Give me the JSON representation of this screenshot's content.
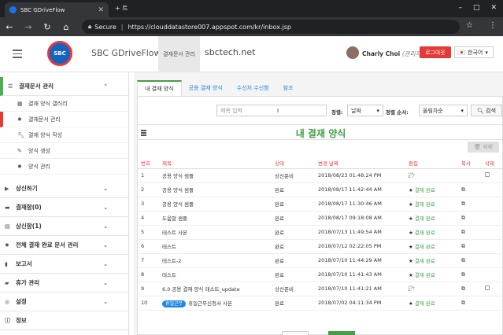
{
  "browser": {
    "tab_title": "SBC GDriveFlow",
    "newtab_label": "+ 트",
    "secure_label": "Secure",
    "url": "https://clouddatastore007.appspot.com/kr/inbox.jsp"
  },
  "header": {
    "app_name": "SBC GDriveFlow",
    "logo_text": "SBC",
    "active_tab": "결재문서 관리",
    "company": "sbctech.net",
    "user_name": "Charly Choi",
    "user_role": "(관리자)",
    "logout_label": "로그아웃",
    "language": "한국어"
  },
  "sidebar": {
    "section_title": "결재문서 관리",
    "subitems": [
      {
        "icon": "grid-icon",
        "label": "결재 양식 갤러리"
      },
      {
        "icon": "gear-icon",
        "label": "결재문서 관리"
      },
      {
        "icon": "wrench-icon",
        "label": "결재 양식 작성"
      },
      {
        "icon": "edit-icon",
        "label": "양식 생성"
      },
      {
        "icon": "cog-icon",
        "label": "양식 관리"
      }
    ],
    "groups": [
      {
        "icon": "play-icon",
        "label": "상신하기"
      },
      {
        "icon": "inbox-icon",
        "label": "결재함(0)"
      },
      {
        "icon": "outbox-icon",
        "label": "상신함(1)"
      },
      {
        "icon": "gear-icon",
        "label": "전체 결재 완료 문서 관리"
      },
      {
        "icon": "report-icon",
        "label": "보고서"
      },
      {
        "icon": "vacation-icon",
        "label": "휴가 관리"
      },
      {
        "icon": "settings-icon",
        "label": "설정"
      },
      {
        "icon": "info-icon",
        "label": "정보"
      }
    ]
  },
  "tabs": [
    "내 결재 양식",
    "공용 결재 양식",
    "수신처 수신함",
    "참조"
  ],
  "filters": {
    "search_placeholder": "제목 입력",
    "sort_label": "정렬:",
    "sort_value": "날짜",
    "order_label": "정렬 순서:",
    "order_value": "올림차순",
    "search_button": "검색"
  },
  "panel_title": "내 결재 양식",
  "delete_label": "삭제",
  "table": {
    "headers": [
      "번호",
      "제목",
      "상태",
      "변경 날짜",
      "편집",
      "복사",
      "삭제"
    ],
    "rows": [
      {
        "num": "1",
        "title": "공용 양식 샘플",
        "status": "상신준비",
        "date": "2018/08/23 01:48:24 PM",
        "edit": "folder",
        "copy": false,
        "delete": true
      },
      {
        "num": "2",
        "title": "공용 양식 샘플",
        "status": "완료",
        "date": "2018/08/17 11:42:44 AM",
        "edit": "결재 완료",
        "copy": true,
        "delete": false
      },
      {
        "num": "3",
        "title": "공용 양식 샘플",
        "status": "완료",
        "date": "2018/08/17 11:30:46 AM",
        "edit": "결재 완료",
        "copy": true,
        "delete": false
      },
      {
        "num": "4",
        "title": "도움말 샘플",
        "status": "완료",
        "date": "2018/08/17 09:18:08 AM",
        "edit": "결재 완료",
        "copy": true,
        "delete": false
      },
      {
        "num": "5",
        "title": "테스트 사본",
        "status": "완료",
        "date": "2018/07/13 11:49:54 AM",
        "edit": "결재 완료",
        "copy": true,
        "delete": false
      },
      {
        "num": "6",
        "title": "테스트",
        "status": "완료",
        "date": "2018/07/12 02:22:05 PM",
        "edit": "결재 완료",
        "copy": true,
        "delete": false
      },
      {
        "num": "7",
        "title": "테스트-2",
        "status": "완료",
        "date": "2018/07/10 11:44:29 AM",
        "edit": "결재 완료",
        "copy": true,
        "delete": false
      },
      {
        "num": "8",
        "title": "테스트",
        "status": "완료",
        "date": "2018/07/10 11:41:43 AM",
        "edit": "결재 완료",
        "copy": true,
        "delete": false
      },
      {
        "num": "9",
        "title": "6.0 공용 결재 양식 테스트_update",
        "status": "상신준비",
        "date": "2018/07/10 11:41:21 AM",
        "edit": "folder",
        "copy": true,
        "delete": true
      },
      {
        "num": "10",
        "badge": "휴일근무",
        "title": "휴일근무신청서 사본",
        "status": "완료",
        "date": "2018/07/02 04:11:34 PM",
        "edit": "결재 완료",
        "copy": true,
        "delete": false
      }
    ]
  }
}
